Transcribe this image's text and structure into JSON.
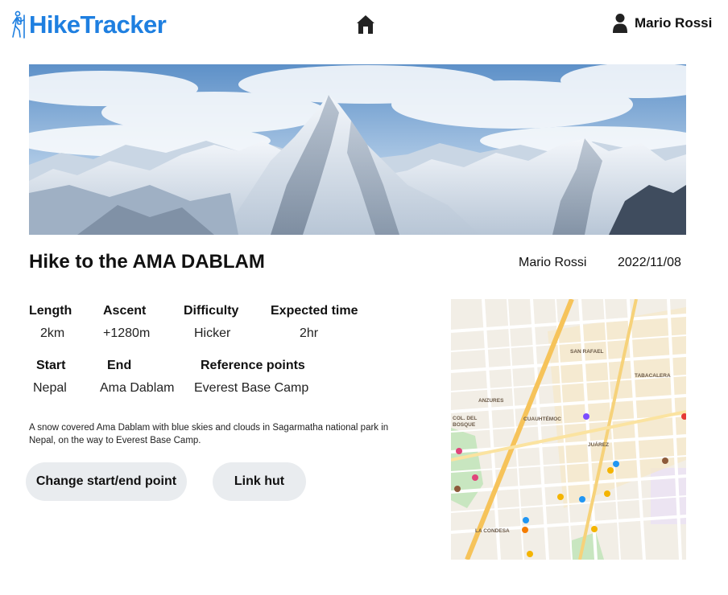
{
  "header": {
    "logo_text": "HikeTracker",
    "user_name": "Mario Rossi"
  },
  "hike": {
    "title": "Hike to the AMA DABLAM",
    "author": "Mario Rossi",
    "date": "2022/11/08",
    "details": {
      "length_label": "Length",
      "length_value": "2km",
      "ascent_label": "Ascent",
      "ascent_value": "+1280m",
      "difficulty_label": "Difficulty",
      "difficulty_value": "Hicker",
      "time_label": "Expected time",
      "time_value": "2hr",
      "start_label": "Start",
      "start_value": "Nepal",
      "end_label": "End",
      "end_value": "Ama Dablam",
      "ref_label": "Reference points",
      "ref_value": "Everest Base Camp"
    },
    "description": "A snow covered Ama Dablam with blue skies and clouds in Sagarmatha national park in Nepal, on the way to Everest Base Camp."
  },
  "actions": {
    "change_label": "Change start/end point",
    "link_label": "Link hut"
  },
  "map": {
    "labels": [
      "SAN RAFAEL",
      "TABACALERA",
      "ANZURES",
      "CUAUHTÉMOC",
      "JUÁREZ",
      "LA CONDESA",
      "COL. DEL BOSQUE"
    ]
  },
  "colors": {
    "brand": "#1e7fe0",
    "button_bg": "#e9ecef"
  },
  "icons": {
    "logo": "hiker-icon",
    "home": "home-icon",
    "user": "user-icon"
  }
}
